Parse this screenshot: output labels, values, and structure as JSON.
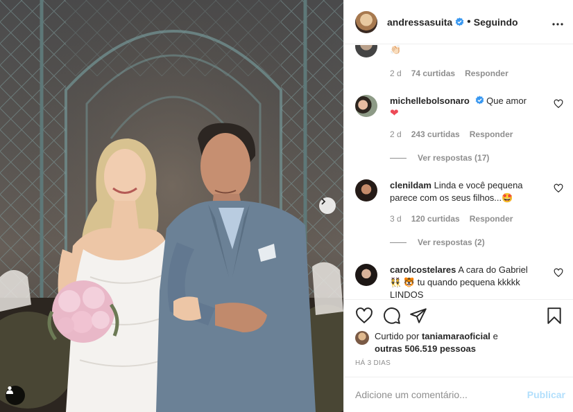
{
  "post": {
    "username": "andressasuita",
    "follow_status": "Seguindo",
    "more_icon": "more-horizontal-icon",
    "next_icon": "chevron-right-icon",
    "user_tag_icon": "user-tag-icon"
  },
  "comments": [
    {
      "text": "👏🏻",
      "time": "2 d",
      "likes": "74 curtidas",
      "reply": "Responder"
    },
    {
      "username": "michellebolsonaro",
      "verified": true,
      "text": "Que amor",
      "text_line2": "❤",
      "time": "2 d",
      "likes": "243 curtidas",
      "reply": "Responder",
      "view_replies": "Ver respostas (17)"
    },
    {
      "username": "clenildam",
      "text": "Linda e você pequena",
      "text_line2": "parece com os seus filhos...🤩",
      "time": "3 d",
      "likes": "120 curtidas",
      "reply": "Responder",
      "view_replies": "Ver respostas (2)"
    },
    {
      "username": "carolcostelares",
      "text": "A cara do Gabriel",
      "text_line2": "👯 🐯 tu quando pequena kkkkk",
      "text_line3": "LINDOS"
    }
  ],
  "actions": {
    "like_icon": "heart-icon",
    "comment_icon": "comment-icon",
    "share_icon": "paper-plane-icon",
    "save_icon": "bookmark-icon"
  },
  "likes_summary": {
    "prefix": "Curtido por",
    "user": "taniamaraoficial",
    "connector": "e",
    "others": "outras 506.519 pessoas"
  },
  "timestamp": "HÁ 3 DIAS",
  "add_comment": {
    "placeholder": "Adicione um comentário...",
    "post_label": "Publicar"
  },
  "colors": {
    "verified": "#3897f0",
    "heart_red": "#ed4956",
    "muted": "#8e8e8e",
    "publish_disabled": "#b2dffc"
  }
}
